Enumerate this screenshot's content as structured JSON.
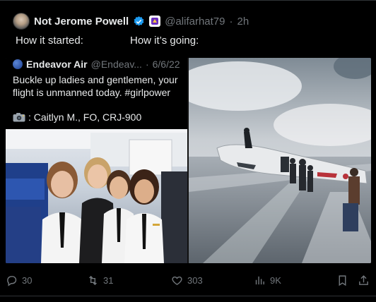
{
  "tweet": {
    "display_name": "Not Jerome Powell",
    "handle": "@alifarhat79",
    "separator": "·",
    "time": "2h",
    "text_left": "How it started:",
    "text_right": "How it’s going:"
  },
  "quoted_tweet": {
    "name": "Endeavor Air",
    "handle": "@Endeav...",
    "separator": "·",
    "date": "6/6/22",
    "body": "Buckle up ladies and gentlemen, your flight is unmanned today. #girlpower",
    "signature": ": Caitlyn M., FO, CRJ-900"
  },
  "actions": {
    "replies": "30",
    "retweets": "31",
    "likes": "303",
    "views": "9K"
  },
  "colors": {
    "background": "#000000",
    "text": "#e7e9ea",
    "muted": "#71767b",
    "verified": "#1d9bf0",
    "affiliate": "#6b2fbf"
  },
  "icons": [
    "avatar",
    "verified-badge-icon",
    "affiliate-badge-icon",
    "camera-icon",
    "reply-icon",
    "retweet-icon",
    "like-icon",
    "views-icon",
    "bookmark-icon",
    "share-icon"
  ]
}
